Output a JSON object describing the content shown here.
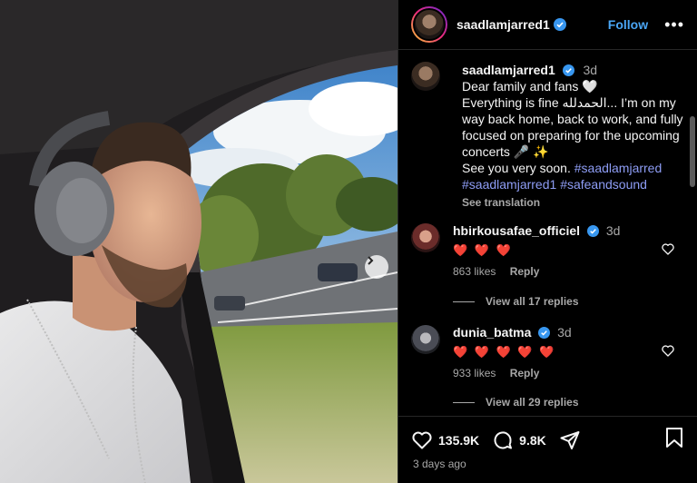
{
  "post": {
    "username": "saadlamjarred1",
    "follow_label": "Follow",
    "more_label": "•••",
    "caption": {
      "username": "saadlamjarred1",
      "age": "3d",
      "line1": "Dear family and fans 🤍",
      "line2": "Everything is fine الحمدلله... I’m on my way back home, back to work, and fully focused on preparing for the upcoming concerts 🎤 ✨",
      "line3": "See you very soon.",
      "hashtag1": "#saadlamjarred",
      "hashtag2": "#saadlamjarred1",
      "hashtag3": "#safeandsound",
      "see_translation": "See translation"
    },
    "comments": [
      {
        "username": "hbirkousafae_officiel",
        "age": "3d",
        "hearts": "❤️ ❤️ ❤️",
        "likes": "863 likes",
        "reply": "Reply",
        "view_replies": "View all 17 replies"
      },
      {
        "username": "dunia_batma",
        "age": "3d",
        "hearts": "❤️ ❤️ ❤️ ❤️ ❤️",
        "likes": "933 likes",
        "reply": "Reply",
        "view_replies": "View all 29 replies"
      }
    ],
    "actions": {
      "likes_count": "135.9K",
      "comments_count": "9.8K"
    },
    "timestamp": "3 days ago"
  },
  "icons": {
    "verified": "verified-badge-icon",
    "like": "heart-icon",
    "comment": "comment-icon",
    "share": "share-icon",
    "save": "bookmark-icon",
    "next": "chevron-right-icon"
  },
  "colors": {
    "link": "#4aa6f5",
    "hashtag": "#8e9df5",
    "heart": "#ed3a3a",
    "verified": "#3897f0"
  }
}
